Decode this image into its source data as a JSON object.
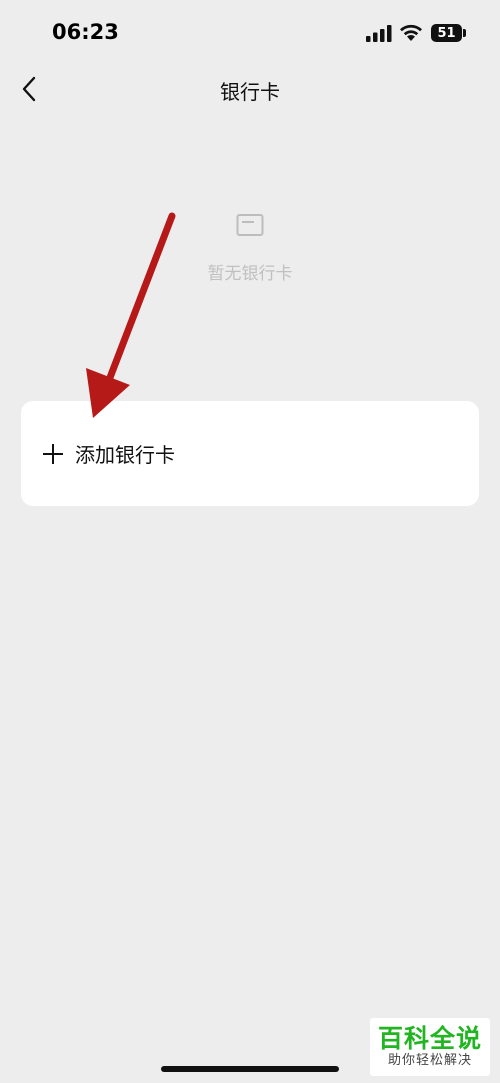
{
  "status": {
    "time": "06:23",
    "battery": "51"
  },
  "nav": {
    "title": "银行卡"
  },
  "empty": {
    "text": "暂无银行卡"
  },
  "add_card": {
    "label": "添加银行卡"
  },
  "watermark": {
    "title": "百科全说",
    "subtitle": "助你轻松解决"
  },
  "icons": {
    "back": "chevron-left-icon",
    "card": "bank-card-icon",
    "plus": "plus-icon",
    "arrow": "red-arrow-annotation"
  },
  "colors": {
    "background": "#ededed",
    "card_bg": "#ffffff",
    "arrow": "#b51a18",
    "watermark_green": "#22b522",
    "muted_text": "#c0c0c0"
  }
}
